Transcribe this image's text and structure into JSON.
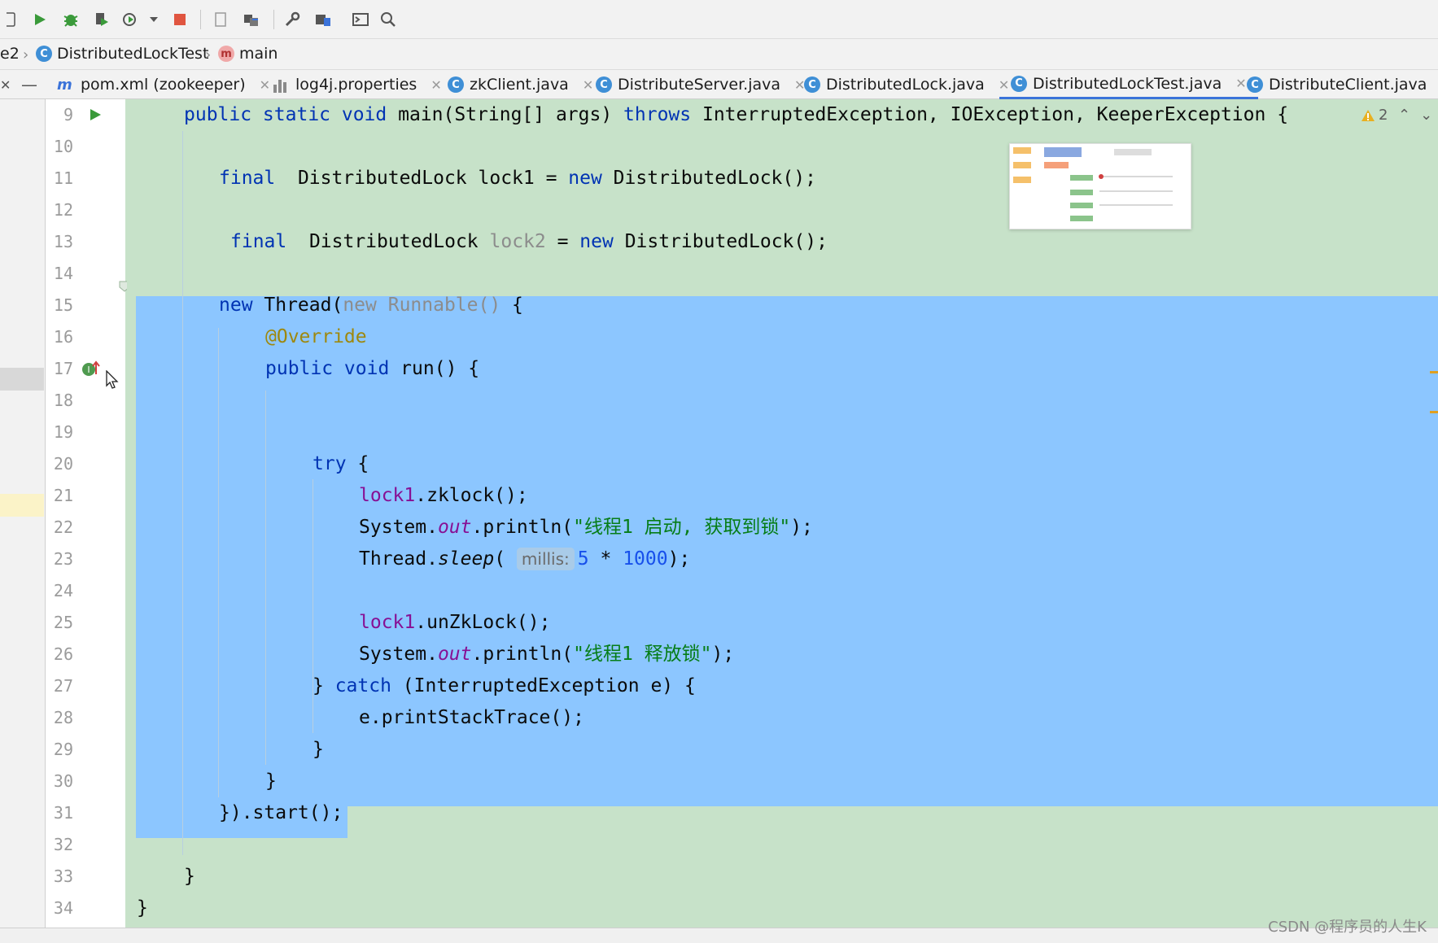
{
  "breadcrumb": {
    "project": "e2",
    "class_name": "DistributedLockTest",
    "method_name": "main"
  },
  "tabs": [
    {
      "label": "pom.xml (zookeeper)",
      "icon": "maven-icon"
    },
    {
      "label": "log4j.properties",
      "icon": "properties-icon"
    },
    {
      "label": "zkClient.java",
      "icon": "class-icon"
    },
    {
      "label": "DistributeServer.java",
      "icon": "class-icon"
    },
    {
      "label": "DistributedLock.java",
      "icon": "class-icon"
    },
    {
      "label": "DistributedLockTest.java",
      "icon": "class-icon",
      "active": true
    },
    {
      "label": "DistributeClient.java",
      "icon": "class-icon"
    }
  ],
  "editor": {
    "line_numbers": [
      "9",
      "10",
      "11",
      "12",
      "13",
      "14",
      "15",
      "16",
      "17",
      "18",
      "19",
      "20",
      "21",
      "22",
      "23",
      "24",
      "25",
      "26",
      "27",
      "28",
      "29",
      "30",
      "31",
      "32",
      "33",
      "34"
    ],
    "warning_count": "2",
    "param_hint": "millis:",
    "code": {
      "l9_kw": "public static void",
      "l9_rest": " main(String[] args) ",
      "l9_throws": "throws",
      "l9_ex": " InterruptedException, IOException, KeeperException {",
      "l11_kw": "final",
      "l11_rest": "  DistributedLock lock1 = ",
      "l11_new": "new",
      "l11_end": " DistributedLock();",
      "l13_kw": "final",
      "l13_rest": "  DistributedLock ",
      "l13_var": "lock2",
      "l13_eq": " = ",
      "l13_new": "new",
      "l13_end": " DistributedLock();",
      "l15_new": "new",
      "l15_thread": " Thread(",
      "l15_runnable": "new Runnable()",
      "l15_end": " {",
      "l16_ann": "@Override",
      "l17_kw": "public void",
      "l17_rest": " run() {",
      "l20_try": "try",
      "l20_end": " {",
      "l21_field": "lock1",
      "l21_rest": ".zklock();",
      "l22_a": "System.",
      "l22_out": "out",
      "l22_b": ".println(",
      "l22_str": "\"线程1 启动, 获取到锁\"",
      "l22_c": ");",
      "l23_a": "Thread.",
      "l23_sleep": "sleep",
      "l23_b": "(",
      "l23_n1": "5",
      "l23_mul": " * ",
      "l23_n2": "1000",
      "l23_c": ");",
      "l25_field": "lock1",
      "l25_rest": ".unZkLock();",
      "l26_a": "System.",
      "l26_out": "out",
      "l26_b": ".println(",
      "l26_str": "\"线程1 释放锁\"",
      "l26_c": ");",
      "l27_a": "} ",
      "l27_catch": "catch",
      "l27_b": " (InterruptedException e) {",
      "l28": "e.printStackTrace();",
      "l29": "}",
      "l30": "}",
      "l31": "}).start();",
      "l33": "}",
      "l34": "}"
    }
  },
  "watermark": "CSDN @程序员的人生K",
  "colors": {
    "editor_bg": "#c7e2c9",
    "selection": "#8cc6ff",
    "keyword": "#0033b3",
    "string": "#067d17",
    "annotation": "#9e880d",
    "field": "#871094",
    "number": "#1750eb"
  }
}
